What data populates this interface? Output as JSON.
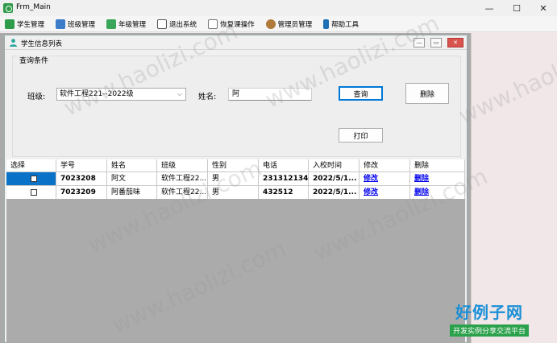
{
  "window": {
    "title": "Frm_Main",
    "min": "—",
    "max": "☐",
    "close": "✕"
  },
  "menu": [
    {
      "label": "学生管理",
      "color": "#2e9c4b"
    },
    {
      "label": "班级管理",
      "color": "#3d7cc9"
    },
    {
      "label": "年级管理",
      "color": "#3aa65a"
    },
    {
      "label": "退出系统",
      "color": "#555555"
    },
    {
      "label": "恢复课操作",
      "color": "#777777"
    },
    {
      "label": "管理员管理",
      "color": "#b07a3a"
    },
    {
      "label": "帮助工具",
      "color": "#1f6fb5"
    }
  ],
  "child": {
    "title": "学生信息列表",
    "query_group": "查询条件",
    "class_label": "班级:",
    "class_value": "软件工程221--2022级",
    "name_label": "姓名:",
    "name_value": "阿",
    "query_button": "查询",
    "delete_button": "删除",
    "print_button": "打印"
  },
  "grid": {
    "columns": [
      "选择",
      "学号",
      "姓名",
      "班级",
      "性别",
      "电话",
      "入校时间",
      "修改",
      "删除"
    ],
    "rows": [
      {
        "id": "7023208",
        "name": "阿文",
        "class": "软件工程22...",
        "gender": "男",
        "phone": "231312134",
        "date": "2022/5/1...",
        "edit": "修改",
        "del": "删除"
      },
      {
        "id": "7023209",
        "name": "阿番茄味",
        "class": "软件工程22...",
        "gender": "男",
        "phone": "432512",
        "date": "2022/5/1...",
        "edit": "修改",
        "del": "删除"
      }
    ]
  },
  "watermark": "www.haolizi.com",
  "brand": {
    "name": "好例子网",
    "tagline": "开发实例分享交流平台"
  }
}
